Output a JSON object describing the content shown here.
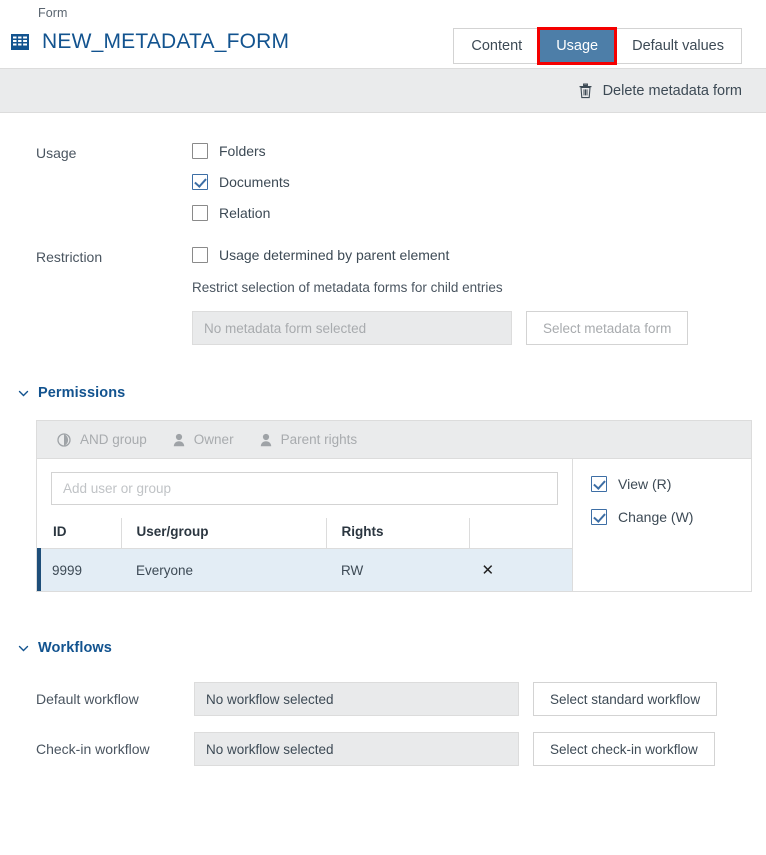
{
  "header": {
    "breadcrumb": "Form",
    "title": "NEW_METADATA_FORM",
    "icon": "table-form-icon",
    "title_color": "#12538f"
  },
  "tabs": {
    "items": [
      {
        "label": "Content",
        "active": false
      },
      {
        "label": "Usage",
        "active": true,
        "highlighted": true
      },
      {
        "label": "Default values",
        "active": false
      }
    ],
    "active_color": "#4d7ea8",
    "highlight_color": "#f40000"
  },
  "toolbar": {
    "delete_label": "Delete metadata form",
    "delete_icon": "trash-icon"
  },
  "usage": {
    "label": "Usage",
    "options": [
      {
        "label": "Folders",
        "checked": false
      },
      {
        "label": "Documents",
        "checked": true
      },
      {
        "label": "Relation",
        "checked": false
      }
    ]
  },
  "restriction": {
    "label": "Restriction",
    "parent_option": {
      "label": "Usage determined by parent element",
      "checked": false
    },
    "note": "Restrict selection of metadata forms for child entries",
    "field_placeholder": "No metadata form selected",
    "select_button": "Select metadata form"
  },
  "permissions": {
    "section_title": "Permissions",
    "tools": [
      {
        "label": "AND group",
        "icon": "and-group-icon"
      },
      {
        "label": "Owner",
        "icon": "user-icon"
      },
      {
        "label": "Parent rights",
        "icon": "user-icon"
      }
    ],
    "search_placeholder": "Add user or group",
    "search_value": "",
    "columns": [
      "ID",
      "User/group",
      "Rights",
      ""
    ],
    "rows": [
      {
        "id": "9999",
        "user": "Everyone",
        "rights": "RW",
        "remove": "✕",
        "selected": true
      }
    ],
    "rights_options": [
      {
        "label": "View (R)",
        "checked": true
      },
      {
        "label": "Change (W)",
        "checked": true
      }
    ]
  },
  "workflows": {
    "section_title": "Workflows",
    "rows": [
      {
        "label": "Default workflow",
        "value": "No workflow selected",
        "button": "Select standard workflow"
      },
      {
        "label": "Check-in workflow",
        "value": "No workflow selected",
        "button": "Select check-in workflow"
      }
    ]
  }
}
